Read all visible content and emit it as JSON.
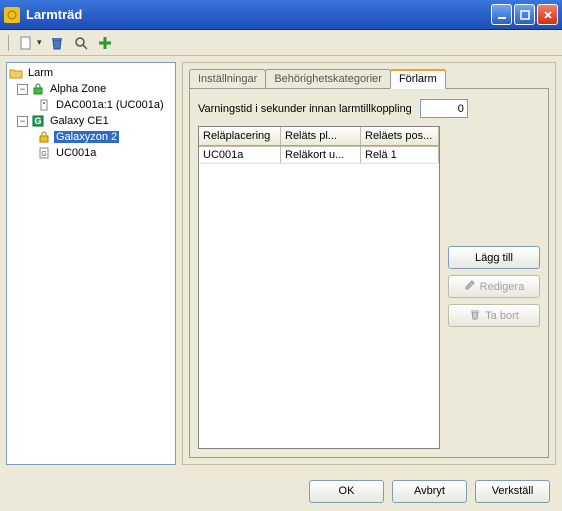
{
  "window": {
    "title": "Larmträd"
  },
  "tree": {
    "root": "Larm",
    "nodes": {
      "alpha": "Alpha Zone",
      "dac": "DAC001a:1 (UC001a)",
      "galaxy": "Galaxy CE1",
      "galaxyzon": "Galaxyzon 2",
      "uc": "UC001a"
    }
  },
  "tabs": {
    "t1": "Inställningar",
    "t2": "Behörighetskategorier",
    "t3": "Förlarm"
  },
  "forlarm": {
    "warn_label": "Varningstid i sekunder innan larmtillkoppling",
    "warn_value": "0"
  },
  "table": {
    "headers": {
      "c1": "Reläplacering",
      "c2": "Reläts pl...",
      "c3": "Reläets pos..."
    },
    "rows": [
      {
        "c1": "UC001a",
        "c2": "Reläkort u...",
        "c3": "Relä 1"
      }
    ]
  },
  "buttons": {
    "add": "Lägg till",
    "edit": "Redigera",
    "delete": "Ta bort",
    "ok": "OK",
    "cancel": "Avbryt",
    "apply": "Verkställ"
  }
}
